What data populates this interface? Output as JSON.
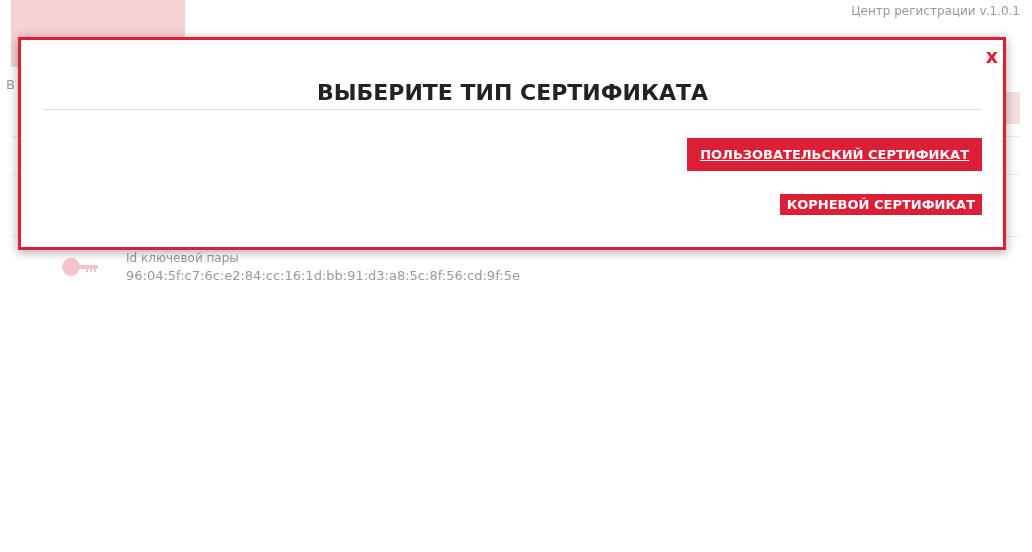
{
  "app": {
    "version": "Центр регистрации v.1.0.1",
    "section_label": "В"
  },
  "key_pair": {
    "label": "Id ключевой пары",
    "value": "96:04:5f:c7:6c:e2:84:cc:16:1d:bb:91:d3:a8:5c:8f:56:cd:9f:5e"
  },
  "dialog": {
    "close": "x",
    "title": "ВЫБЕРИТЕ ТИП СЕРТИФИКАТА",
    "buttons": [
      {
        "label": "ПОЛЬЗОВАТЕЛЬСКИЙ СЕРТИФИКАТ",
        "selected": true
      },
      {
        "label": "КОРНЕВОЙ СЕРТИФИКАТ",
        "selected": false
      }
    ]
  }
}
